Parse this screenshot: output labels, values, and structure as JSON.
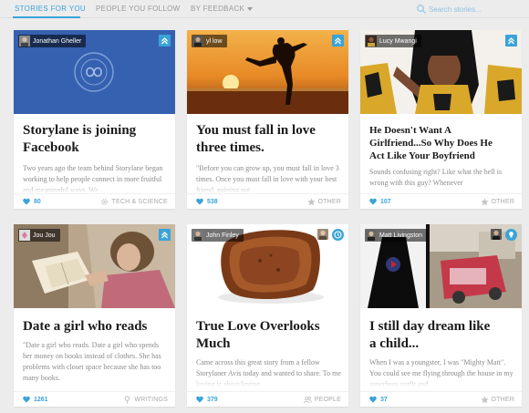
{
  "tabs": [
    {
      "label": "Stories for you",
      "active": true
    },
    {
      "label": "People you follow",
      "active": false
    },
    {
      "label": "By feedback",
      "active": false
    }
  ],
  "search": {
    "placeholder": "Search stories..."
  },
  "cards": [
    {
      "author": "Jonathan Gheller",
      "title_lines": [
        "Storylane is joining",
        "Facebook"
      ],
      "excerpt": "Two years ago the team behind Storylane began working to help people connect in more fruitful and meaningful ways. We",
      "likes": "80",
      "category": "Tech & Science",
      "category_icon": "gear-icon"
    },
    {
      "author": "yl low",
      "title_lines": [
        "You must fall in love",
        "three times."
      ],
      "excerpt": "\"Before you can grow up, you must fall in love 3 times. Once you must fall in love with your best friend, gaining not",
      "likes": "538",
      "category": "Other",
      "category_icon": "star-icon"
    },
    {
      "author": "Lucy Mwangi",
      "title_lines": [
        "He Doesn't Want A",
        "Girlfriend...So Why Does He",
        "Act Like Your Boyfriend"
      ],
      "excerpt": "Sounds confusing right? Like what the hell is wrong with this guy? Whenever",
      "likes": "107",
      "category": "Other",
      "category_icon": "star-icon"
    },
    {
      "author": "Jou Jou",
      "title_lines": [
        "Date a girl who reads"
      ],
      "excerpt": "\"Date a girl who reads. Date a girl who spends her money on books instead of clothes. She has problems with closet space because she has too many books.",
      "likes": "1261",
      "category": "Writings",
      "category_icon": "pen-icon"
    },
    {
      "author": "John Finley",
      "title_lines": [
        "True Love Overlooks",
        "Much"
      ],
      "excerpt": "Came across this great story from a fellow Storylaner Avis today and wanted to share. To me loving is about loving",
      "likes": "379",
      "category": "People",
      "category_icon": "people-icon"
    },
    {
      "author": "Matt Livingston",
      "title_lines": [
        "I still day dream like",
        "a child..."
      ],
      "excerpt": "When I was a youngster, I was \"Mighty Matt\". You could see me flying through the house in my superhero outfit and",
      "likes": "37",
      "category": "Other",
      "category_icon": "star-icon"
    }
  ],
  "colors": {
    "accent": "#3aa3d9",
    "background": "#ececec",
    "card": "#ffffff"
  }
}
